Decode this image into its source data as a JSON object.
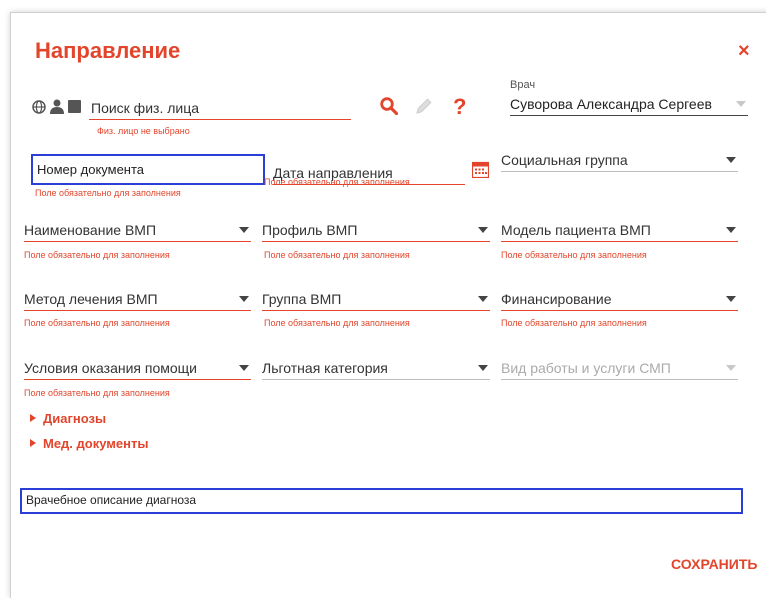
{
  "dialog": {
    "title": "Направление",
    "close_label": "×",
    "save_label": "СОХРАНИТЬ"
  },
  "person_search": {
    "placeholder": "Поиск физ. лица",
    "status": "Физ. лицо не выбрано"
  },
  "doctor": {
    "label": "Врач",
    "value": "Суворова Александра Сергеев"
  },
  "required_message": "Поле обязательно для заполнения",
  "fields": {
    "doc_number": "Номер документа",
    "referral_date": "Дата направления",
    "social_group": "Социальная группа",
    "vmp_name": "Наименование ВМП",
    "vmp_profile": "Профиль ВМП",
    "vmp_patient_model": "Модель пациента ВМП",
    "vmp_method": "Метод лечения ВМП",
    "vmp_group": "Группа ВМП",
    "financing": "Финансирование",
    "care_conditions": "Условия оказания помощи",
    "benefit_category": "Льготная категория",
    "smp_work_type": "Вид работы и услуги СМП",
    "diagnosis_description": "Врачебное описание диагноза"
  },
  "sections": {
    "diagnoses": "Диагнозы",
    "med_documents": "Мед. документы"
  },
  "colors": {
    "accent": "#e2452b",
    "highlight_border": "#2a3fd6"
  }
}
